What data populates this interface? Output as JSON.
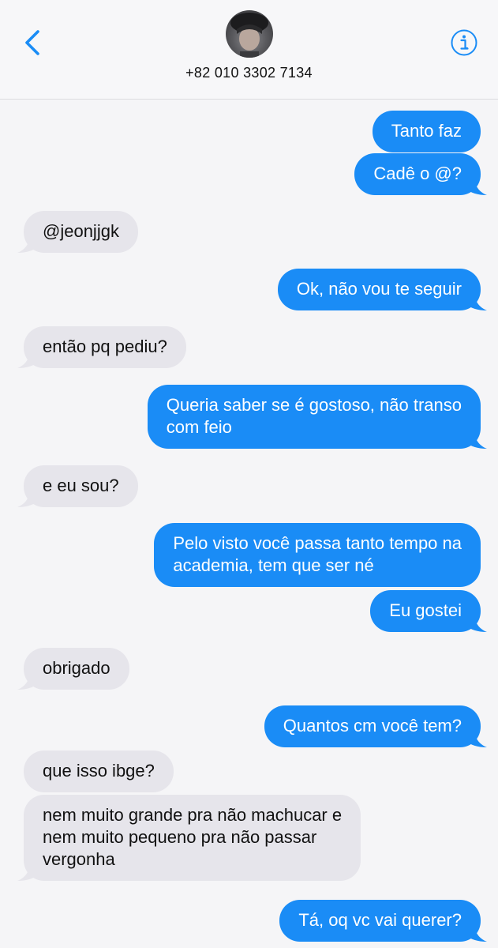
{
  "header": {
    "back_icon": "chevron-left-icon",
    "avatar": "contact-photo",
    "contact_name": "+82 010 3302 7134",
    "info_icon": "info-circle-icon"
  },
  "colors": {
    "accent": "#1a8cf6",
    "outgoing_bubble": "#1a8cf6",
    "incoming_bubble": "#e6e5eb",
    "background": "#f5f5f7"
  },
  "messages": [
    {
      "dir": "out",
      "text": "Tanto faz"
    },
    {
      "dir": "out",
      "text": "Cadê o @?"
    },
    {
      "dir": "in",
      "text": "@jeonjjgk"
    },
    {
      "dir": "out",
      "text": "Ok, não vou te seguir"
    },
    {
      "dir": "in",
      "text": "então pq pediu?"
    },
    {
      "dir": "out",
      "lines": [
        "Queria saber se é gostoso, não transo",
        "com feio"
      ]
    },
    {
      "dir": "in",
      "text": "e eu sou?"
    },
    {
      "dir": "out",
      "lines": [
        "Pelo visto você passa tanto tempo na",
        "academia, tem que ser né"
      ]
    },
    {
      "dir": "out",
      "text": "Eu gostei"
    },
    {
      "dir": "in",
      "text": "obrigado"
    },
    {
      "dir": "out",
      "text": "Quantos cm você tem?"
    },
    {
      "dir": "in",
      "text": "que isso ibge?"
    },
    {
      "dir": "in",
      "lines": [
        "nem muito grande pra não machucar e",
        "nem muito pequeno pra não passar",
        "vergonha"
      ]
    },
    {
      "dir": "out",
      "text": "Tá, oq vc vai querer?"
    }
  ]
}
